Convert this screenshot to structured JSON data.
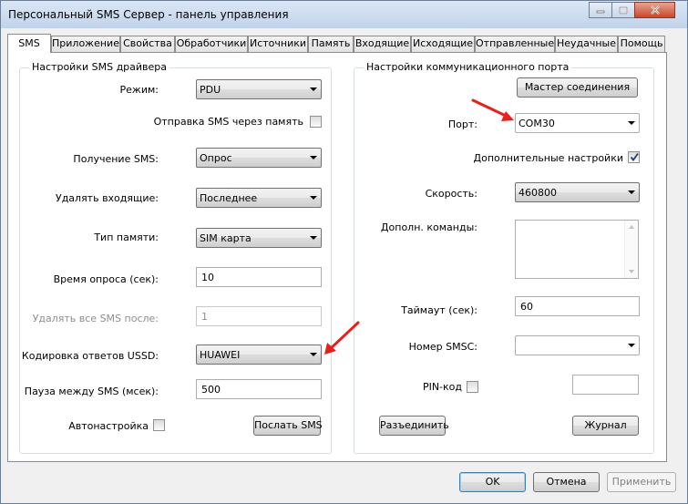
{
  "window": {
    "title": "Персональный SMS Сервер - панель управления"
  },
  "tabs": [
    {
      "label": "SMS",
      "active": true
    },
    {
      "label": "Приложение"
    },
    {
      "label": "Свойства"
    },
    {
      "label": "Обработчики"
    },
    {
      "label": "Источники"
    },
    {
      "label": "Память"
    },
    {
      "label": "Входящие"
    },
    {
      "label": "Исходящие"
    },
    {
      "label": "Отправленные"
    },
    {
      "label": "Неудачные"
    },
    {
      "label": "Помощь"
    }
  ],
  "driver": {
    "group_label": "Настройки SMS драйвера",
    "mode": {
      "label": "Режим:",
      "value": "PDU"
    },
    "send_via_memory": {
      "label": "Отправка SMS через память",
      "checked": false
    },
    "receive": {
      "label": "Получение SMS:",
      "value": "Опрос"
    },
    "delete_incoming": {
      "label": "Удалять входящие:",
      "value": "Последнее"
    },
    "memory_type": {
      "label": "Тип памяти:",
      "value": "SIM карта"
    },
    "poll_time": {
      "label": "Время опроса (сек):",
      "value": "10"
    },
    "delete_all_after": {
      "label": "Удалять все SMS после:",
      "value": "1"
    },
    "ussd_encoding": {
      "label": "Кодировка ответов USSD:",
      "value": "HUAWEI"
    },
    "pause": {
      "label": "Пауза между SMS (мсек):",
      "value": "500"
    },
    "autosetup": {
      "label": "Автонастройка",
      "checked": false
    },
    "send_sms_button": "Послать SMS"
  },
  "port": {
    "group_label": "Настройки коммуникационного порта",
    "wizard_button": "Мастер соединения",
    "port": {
      "label": "Порт:",
      "value": "COM30"
    },
    "extra_settings": {
      "label": "Дополнительные настройки",
      "checked": true
    },
    "speed": {
      "label": "Скорость:",
      "value": "460800"
    },
    "extra_commands": {
      "label": "Дополн. команды:",
      "value": ""
    },
    "timeout": {
      "label": "Таймаут (сек):",
      "value": "60"
    },
    "smsc": {
      "label": "Номер SMSC:",
      "value": ""
    },
    "pin": {
      "label": "PIN-код",
      "checked": false,
      "value": ""
    },
    "disconnect_button": "Разъединить",
    "log_button": "Журнал"
  },
  "footer": {
    "ok": "OK",
    "cancel": "Отмена",
    "apply": "Применить"
  },
  "colors": {
    "annotation_arrow": "#e8201c",
    "check_mark": "#1a3f7a"
  },
  "icons": [
    "minimize-icon",
    "maximize-icon",
    "close-icon",
    "check-icon",
    "chevron-down-icon",
    "red-arrow-icon"
  ]
}
